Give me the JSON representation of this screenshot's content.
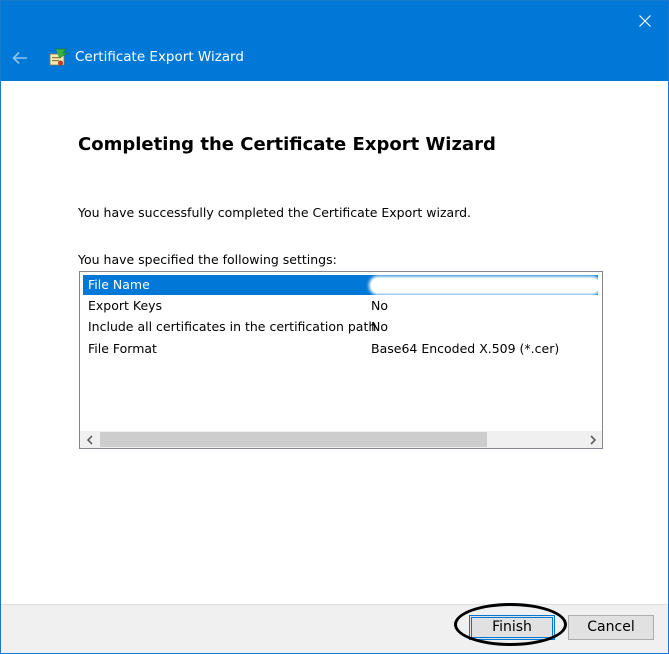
{
  "window": {
    "title": "Certificate Export Wizard",
    "accent_color": "#0078d7"
  },
  "icons": {
    "close": "close-icon",
    "back": "back-arrow-icon",
    "wizard": "certificate-wizard-icon"
  },
  "page": {
    "heading": "Completing the Certificate Export Wizard",
    "success_message": "You have successfully completed the Certificate Export wizard.",
    "settings_label": "You have specified the following settings:"
  },
  "settings": [
    {
      "key": "File Name",
      "value": ""
    },
    {
      "key": "Export Keys",
      "value": "No"
    },
    {
      "key": "Include all certificates in the certification path",
      "value": "No"
    },
    {
      "key": "File Format",
      "value": "Base64 Encoded X.509 (*.cer)"
    }
  ],
  "buttons": {
    "finish": "Finish",
    "cancel": "Cancel"
  }
}
